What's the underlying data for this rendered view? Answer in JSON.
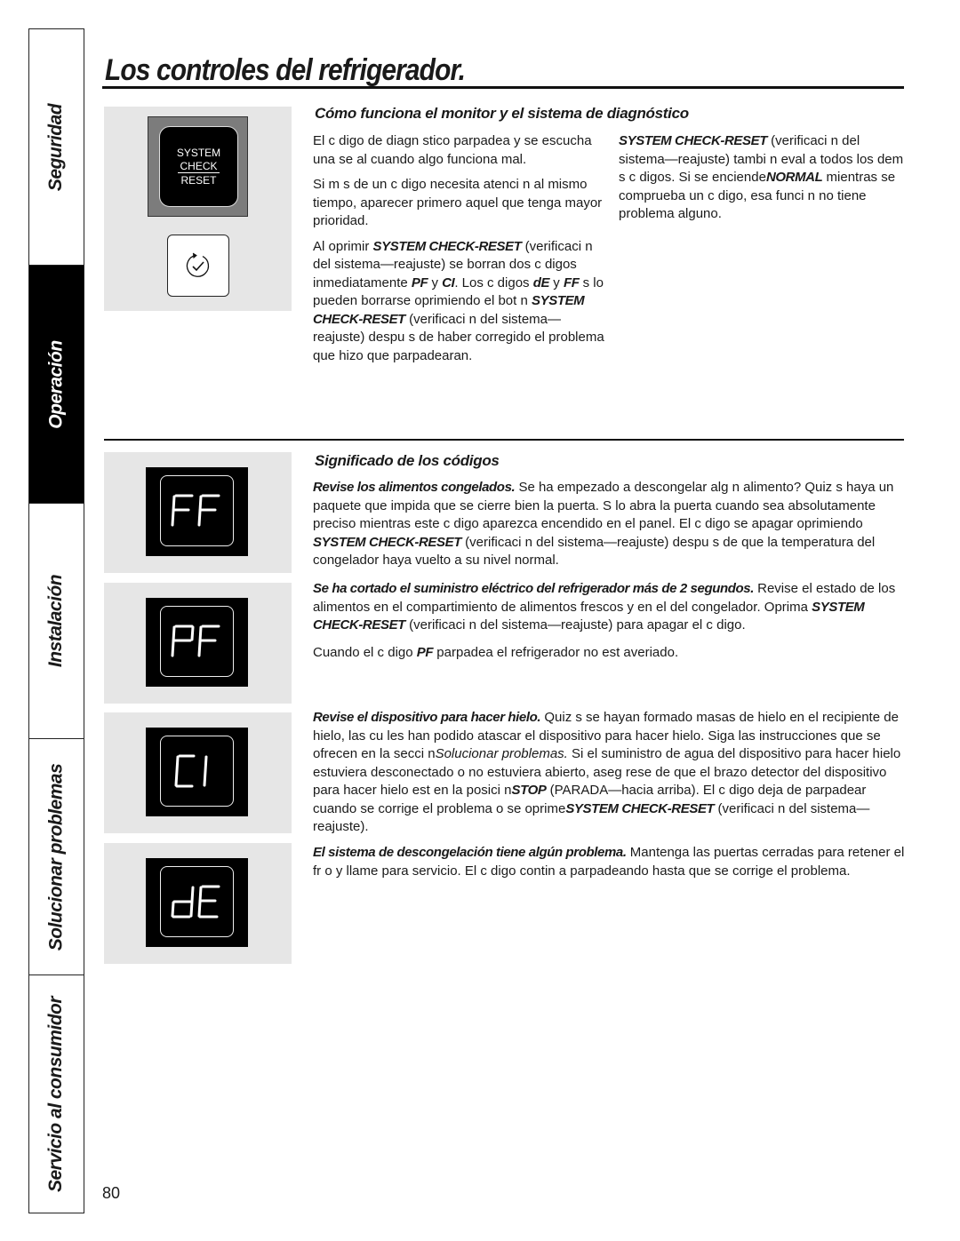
{
  "sidebar": {
    "tabs": [
      {
        "label": "Seguridad",
        "active": false
      },
      {
        "label": "Operación",
        "active": true
      },
      {
        "label": "Instalación",
        "active": false
      },
      {
        "label": "Solucionar problemas",
        "active": false
      },
      {
        "label": "Servicio al consumidor",
        "active": false
      }
    ]
  },
  "header": {
    "title": "Los controles del refrigerador."
  },
  "panel_button": {
    "line1": "SYSTEM",
    "line2": "CHECK",
    "line3": "RESET",
    "icon": "check-cycle-icon"
  },
  "section1": {
    "heading": "Cómo funciona el monitor y el sistema de diagnóstico",
    "p1": "El c digo de diagn stico parpadea y se escucha una se al cuando algo funciona mal.",
    "p2": "Si m s de un c digo necesita atenci n al mismo tiempo, aparecer  primero aquel que tenga mayor prioridad.",
    "p3": {
      "a": "Al oprimir ",
      "k1": "SYSTEM CHECK-RESET",
      "b": " (verificaci n del sistema—reajuste) se borran dos c digos inmediatamente  ",
      "k2": "PF",
      "c": " y ",
      "k3": "CI",
      "d": ". Los c digos ",
      "k4": "dE",
      "e": " y ",
      "k5": "FF",
      "f": " s lo pueden borrarse oprimiendo el bot n  ",
      "k6": "SYSTEM CHECK-RESET",
      "g": " (verificaci n del sistema—reajuste) despu s de haber corregido el problema que hizo que parpadearan."
    },
    "p4": {
      "k1": "SYSTEM CHECK-RESET",
      "a": " (verificaci n del sistema—reajuste) tambi n eval a todos los dem s c digos. Si se enciende",
      "k2": "NORMAL",
      "b": " mientras se comprueba un c digo, esa funci n no tiene problema alguno."
    }
  },
  "section2": {
    "heading": "Significado de los códigos",
    "codes": [
      {
        "code": "FF",
        "lead": "Revise los alimentos congelados.",
        "a": " Se ha empezado a descongelar alg n alimento? Quiz s haya un paquete que impida que se cierre bien la puerta. S lo abra la puerta cuando sea absolutamente preciso mientras este c digo aparezca encendido en el panel. El c digo se apagar  oprimiendo  ",
        "k1": "SYSTEM CHECK-RESET",
        "b": " (verificaci n del sistema—reajuste) despu s de que la temperatura del congelador haya vuelto a su nivel normal."
      },
      {
        "code": "PF",
        "lead": "Se ha cortado el suministro eléctrico del refrigerador más de 2 segundos.",
        "a": " Revise el estado de los alimentos en el compartimiento de alimentos frescos y en el del congelador. Oprima ",
        "k1": "SYSTEM CHECK-RESET",
        "b": " (verificaci n del sistema—reajuste) para apagar el c digo.",
        "note_a": "Cuando el c digo  ",
        "note_k": "PF",
        "note_b": " parpadea el refrigerador no est  averiado."
      },
      {
        "code": "CI",
        "lead": "Revise el dispositivo para hacer hielo.",
        "a": " Quiz s se hayan formado masas de hielo en el recipiente de hielo, las cu les han podido atascar el dispositivo para hacer hielo. Siga las instrucciones que se ofrecen en la secci n",
        "ref": "Solucionar problemas.",
        "b": " Si el suministro de agua del dispositivo para hacer hielo estuviera desconectado o no estuviera abierto, aseg rese de que el brazo detector del dispositivo para hacer hielo est  en la posici n",
        "k1": "STOP",
        "c": " (PARADA—hacia arriba). El c digo deja de parpadear cuando se corrige el problema o se oprime",
        "k2": "SYSTEM CHECK-RESET",
        "d": " (verificaci n del sistema—reajuste)."
      },
      {
        "code": "dE",
        "lead": "El sistema de descongelación tiene algún problema.",
        "a": " Mantenga las puertas cerradas para retener el fr o y llame para servicio. El c digo contin a parpadeando hasta que se corrige el problema."
      }
    ]
  },
  "footer": {
    "page_number": "80"
  }
}
